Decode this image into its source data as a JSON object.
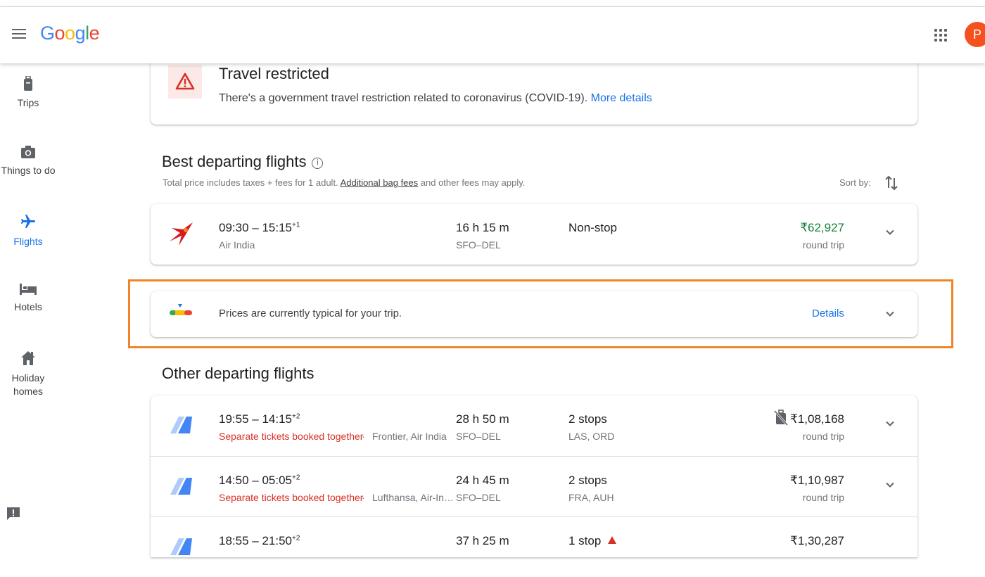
{
  "header": {
    "logo": [
      {
        "ch": "G",
        "color": "#4285f4"
      },
      {
        "ch": "o",
        "color": "#ea4335"
      },
      {
        "ch": "o",
        "color": "#fbbc05"
      },
      {
        "ch": "g",
        "color": "#4285f4"
      },
      {
        "ch": "l",
        "color": "#34a853"
      },
      {
        "ch": "e",
        "color": "#ea4335"
      }
    ],
    "avatar_letter": "P"
  },
  "sidebar": {
    "items": [
      {
        "label": "Trips",
        "icon": "luggage-icon"
      },
      {
        "label": "Things to do",
        "icon": "camera-icon"
      },
      {
        "label": "Flights",
        "icon": "airplane-icon",
        "active": true
      },
      {
        "label": "Hotels",
        "icon": "bed-icon"
      },
      {
        "label": "Holiday homes",
        "icon": "house-icon"
      }
    ]
  },
  "restriction": {
    "title": "Travel restricted",
    "text": "There's a government travel restriction related to coronavirus (COVID-19).",
    "link": "More details"
  },
  "best": {
    "title": "Best departing flights",
    "note_prefix": "Total price includes taxes + fees for 1 adult. ",
    "note_link": "Additional bag fees",
    "note_suffix": " and other fees may apply.",
    "sort_label": "Sort by:",
    "flights": [
      {
        "times": "09:30 – 15:15",
        "plus": "+1",
        "airline": "Air India",
        "duration": "16 h 15 m",
        "route": "SFO–DEL",
        "stops": "Non-stop",
        "price": "₹62,927",
        "price_note": "round trip"
      }
    ]
  },
  "price_insight": {
    "text": "Prices are currently typical for your trip.",
    "link": "Details"
  },
  "other": {
    "title": "Other departing flights",
    "flights": [
      {
        "times": "19:55 – 14:15",
        "plus": "+2",
        "warning": "Separate tickets booked together",
        "airline": "Frontier, Air India",
        "duration": "28 h 50 m",
        "route": "SFO–DEL",
        "stops": "2 stops",
        "stop_airports": "LAS, ORD",
        "price": "₹1,08,168",
        "price_note": "round trip"
      },
      {
        "times": "14:50 – 05:05",
        "plus": "+2",
        "warning": "Separate tickets booked together",
        "airline": "Lufthansa, Air-In…",
        "duration": "24 h 45 m",
        "route": "SFO–DEL",
        "stops": "2 stops",
        "stop_airports": "FRA, AUH",
        "price": "₹1,10,987",
        "price_note": "round trip"
      },
      {
        "times": "18:55 – 21:50",
        "plus": "+2",
        "duration": "37 h 25 m",
        "stops": "1 stop",
        "price": "₹1,30,287"
      }
    ]
  },
  "colors": {
    "accent": "#1a73e8",
    "price_green": "#188038",
    "warning_red": "#d93025",
    "highlight": "#f08428"
  }
}
